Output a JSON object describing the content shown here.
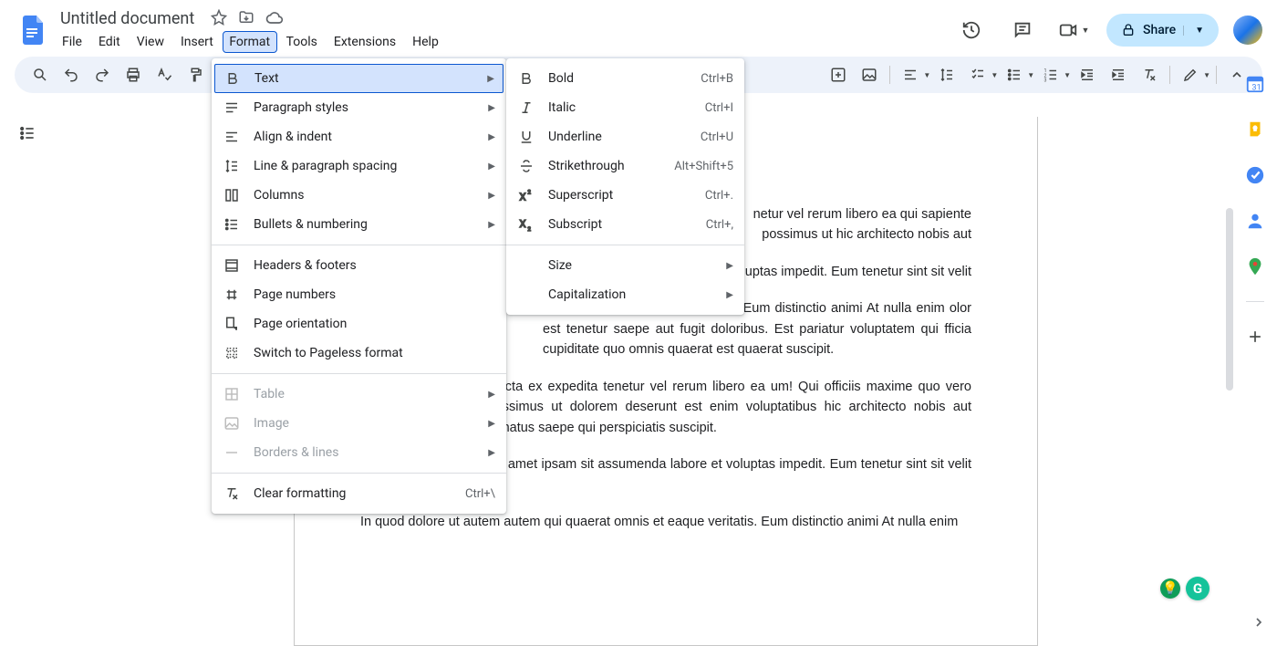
{
  "header": {
    "doc_title": "Untitled document",
    "menubar": [
      "File",
      "Edit",
      "View",
      "Insert",
      "Format",
      "Tools",
      "Extensions",
      "Help"
    ],
    "active_menu_index": 4,
    "share_label": "Share"
  },
  "format_menu": {
    "groups": [
      [
        {
          "icon": "bold",
          "label": "Text",
          "arrow": true,
          "active": true
        },
        {
          "icon": "paragraph",
          "label": "Paragraph styles",
          "arrow": true
        },
        {
          "icon": "align",
          "label": "Align & indent",
          "arrow": true
        },
        {
          "icon": "spacing",
          "label": "Line & paragraph spacing",
          "arrow": true
        },
        {
          "icon": "columns",
          "label": "Columns",
          "arrow": true
        },
        {
          "icon": "bullets",
          "label": "Bullets & numbering",
          "arrow": true
        }
      ],
      [
        {
          "icon": "headers",
          "label": "Headers & footers"
        },
        {
          "icon": "pagenum",
          "label": "Page numbers"
        },
        {
          "icon": "orientation",
          "label": "Page orientation"
        },
        {
          "icon": "pageless",
          "label": "Switch to Pageless format"
        }
      ],
      [
        {
          "icon": "table",
          "label": "Table",
          "arrow": true,
          "disabled": true
        },
        {
          "icon": "image",
          "label": "Image",
          "arrow": true,
          "disabled": true
        },
        {
          "icon": "borders",
          "label": "Borders & lines",
          "arrow": true,
          "disabled": true
        }
      ],
      [
        {
          "icon": "clear",
          "label": "Clear formatting",
          "shortcut": "Ctrl+\\"
        }
      ]
    ]
  },
  "text_submenu": {
    "groups": [
      [
        {
          "icon": "bold",
          "label": "Bold",
          "shortcut": "Ctrl+B"
        },
        {
          "icon": "italic",
          "label": "Italic",
          "shortcut": "Ctrl+I"
        },
        {
          "icon": "underline",
          "label": "Underline",
          "shortcut": "Ctrl+U"
        },
        {
          "icon": "strike",
          "label": "Strikethrough",
          "shortcut": "Alt+Shift+5"
        },
        {
          "icon": "super",
          "label": "Superscript",
          "shortcut": "Ctrl+."
        },
        {
          "icon": "sub",
          "label": "Subscript",
          "shortcut": "Ctrl+,"
        }
      ],
      [
        {
          "icon": "",
          "label": "Size",
          "arrow": true
        },
        {
          "icon": "",
          "label": "Capitalization",
          "arrow": true
        }
      ]
    ]
  },
  "document": {
    "paragraphs": [
      "netur vel rerum libero ea qui sapiente possimus ut hic architecto nobis aut",
      "m sit assumenda labore et voluptas impedit. Eum tenetur sint sit velit",
      "quaerat omnis et eaque veritatis. Eum distinctio animi At nulla enim olor est tenetur saepe aut fugit doloribus. Est pariatur voluptatem qui fficia cupiditate quo omnis quaerat est quaerat suscipit.",
      "rror earum sed quam dicta ex expedita tenetur vel rerum libero ea um! Qui officiis maxime quo vero neque qui sapiente possimus ut dolorem deserunt est enim voluptatibus hic architecto nobis aut necessitatibus libero ea natus saepe qui perspiciatis suscipit.",
      "Et consequatur dolor vel amet ipsam sit assumenda labore et voluptas impedit. Eum tenetur sint sit velit itaque non culpa culpa.",
      "In quod dolore ut autem autem qui quaerat omnis et eaque veritatis. Eum distinctio animi At nulla enim"
    ]
  },
  "right_rail": {
    "apps": [
      "calendar",
      "keep",
      "tasks",
      "contacts",
      "maps"
    ]
  }
}
